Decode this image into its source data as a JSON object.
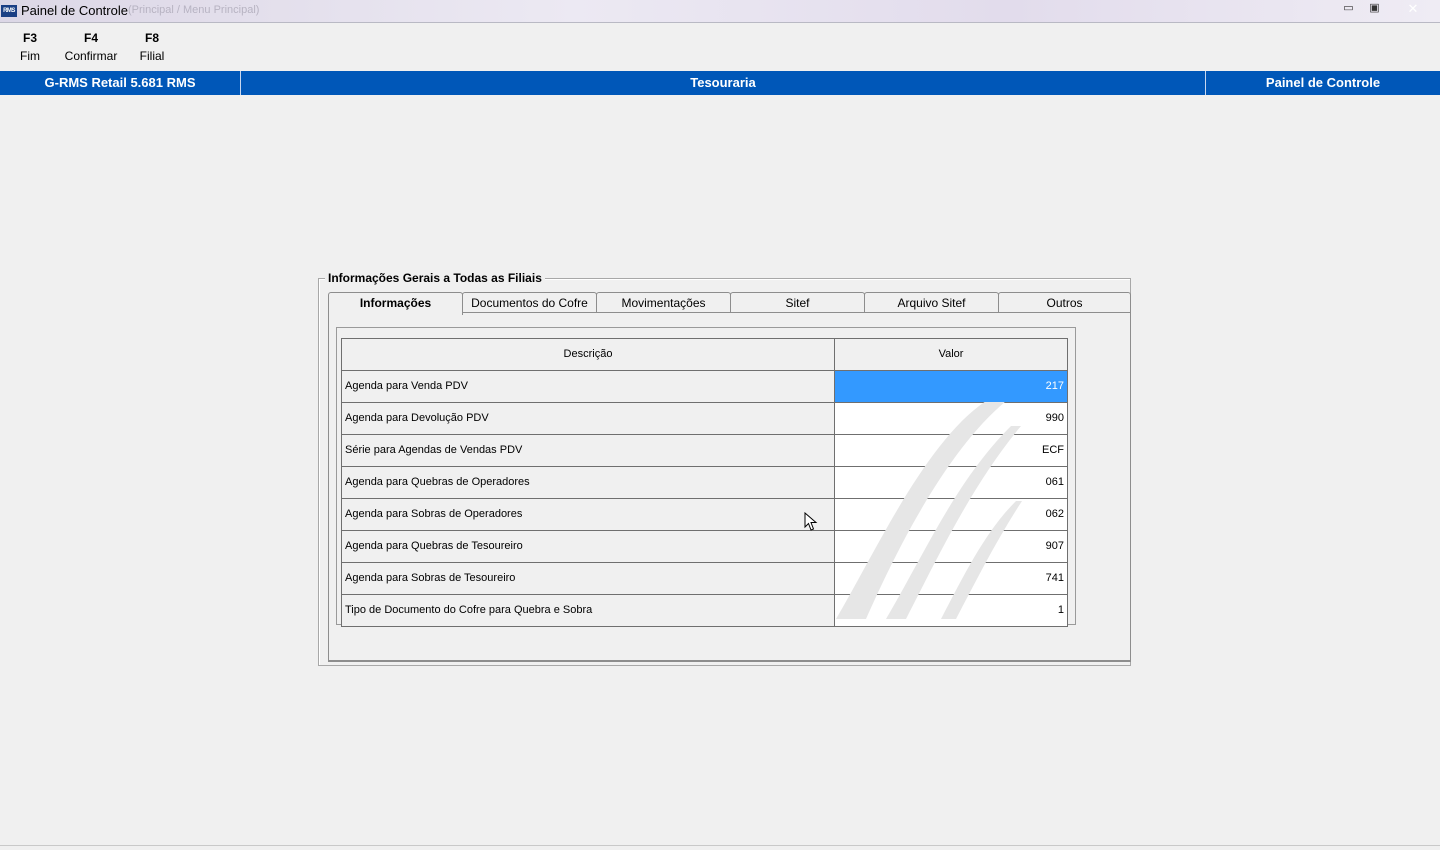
{
  "window": {
    "title": "Painel de Controle",
    "subtitle": "(Principal / Menu Principal)",
    "app_icon": "RMS",
    "controls": {
      "minimize": "▭",
      "maximize": "▣",
      "close": "✕"
    }
  },
  "toolbar": {
    "keys": [
      {
        "key": "F3",
        "label": "Fim"
      },
      {
        "key": "F4",
        "label": "Confirmar"
      },
      {
        "key": "F8",
        "label": "Filial"
      }
    ]
  },
  "header": {
    "product": "G-RMS Retail 5.681 RMS",
    "module": "Tesouraria",
    "screen": "Painel de Controle"
  },
  "group": {
    "title": "Informações Gerais a Todas as Filiais"
  },
  "tabs": [
    {
      "label": "Informações",
      "active": true
    },
    {
      "label": "Documentos do Cofre",
      "active": false
    },
    {
      "label": "Movimentações",
      "active": false
    },
    {
      "label": "Sitef",
      "active": false
    },
    {
      "label": "Arquivo  Sitef",
      "active": false
    },
    {
      "label": "Outros",
      "active": false
    }
  ],
  "grid": {
    "columns": {
      "descricao": "Descrição",
      "valor": "Valor"
    },
    "rows": [
      {
        "descricao": "Agenda para Venda PDV",
        "valor": "217",
        "selected": true
      },
      {
        "descricao": "Agenda para Devolução PDV",
        "valor": "990"
      },
      {
        "descricao": "Série para Agendas de Vendas PDV",
        "valor": "ECF"
      },
      {
        "descricao": "Agenda para Quebras de Operadores",
        "valor": "061"
      },
      {
        "descricao": "Agenda para Sobras de Operadores",
        "valor": "062"
      },
      {
        "descricao": "Agenda para Quebras de Tesoureiro",
        "valor": "907"
      },
      {
        "descricao": "Agenda para Sobras de Tesoureiro",
        "valor": "741"
      },
      {
        "descricao": "Tipo de Documento do Cofre para Quebra e Sobra",
        "valor": "1"
      }
    ],
    "selection_color": "#3399ff"
  },
  "colors": {
    "header_blue": "#0057b8",
    "background": "#f0f0f0"
  }
}
